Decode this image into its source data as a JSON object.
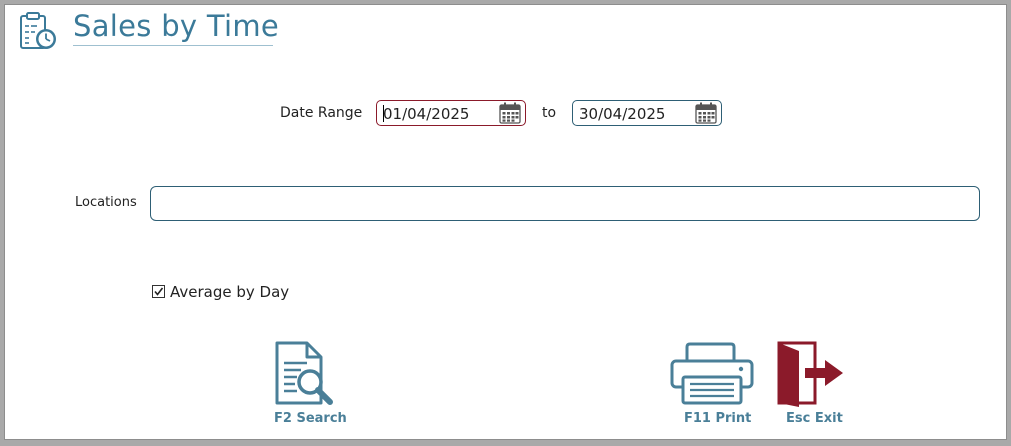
{
  "title": "Sales by Time",
  "date_range": {
    "label": "Date Range",
    "from": "01/04/2025",
    "to_label": "to",
    "to": "30/04/2025"
  },
  "locations": {
    "label": "Locations",
    "value": ""
  },
  "average_by_day": {
    "label": "Average by Day",
    "checked": true
  },
  "buttons": {
    "search": "F2 Search",
    "print": "F11 Print",
    "exit": "Esc Exit"
  },
  "colors": {
    "accent": "#3b7a99",
    "icon": "#4a7f98",
    "exit": "#8b1a2a"
  }
}
